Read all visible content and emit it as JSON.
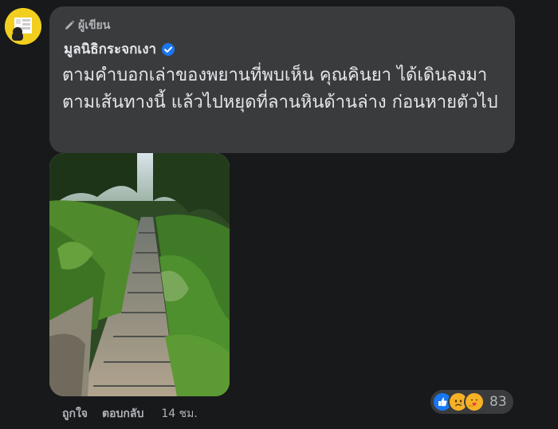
{
  "comment": {
    "author_badge_label": "ผู้เขียน",
    "author_name": "มูลนิธิกระจกเงา",
    "text": "ตามคำบอกเล่าของพยานที่พบเห็น คุณคินยา ได้เดินลงมาตามเส้นทางนี้ แล้วไปหยุดที่ลานหินด้านล่าง ก่อนหายตัวไป",
    "attachment_icon": "photo-of-stone-staircase-path"
  },
  "actions": {
    "like_label": "ถูกใจ",
    "reply_label": "ตอบกลับ",
    "timestamp": "14 ชม."
  },
  "reactions": {
    "icons": [
      "like-icon",
      "sad-icon",
      "care-icon"
    ],
    "count": "83"
  },
  "colors": {
    "background": "#18191a",
    "bubble": "#3a3b3c",
    "text_primary": "#e4e6eb",
    "text_secondary": "#b0b3b8",
    "verified_blue": "#1877f2",
    "avatar_yellow": "#f2cf1f"
  }
}
